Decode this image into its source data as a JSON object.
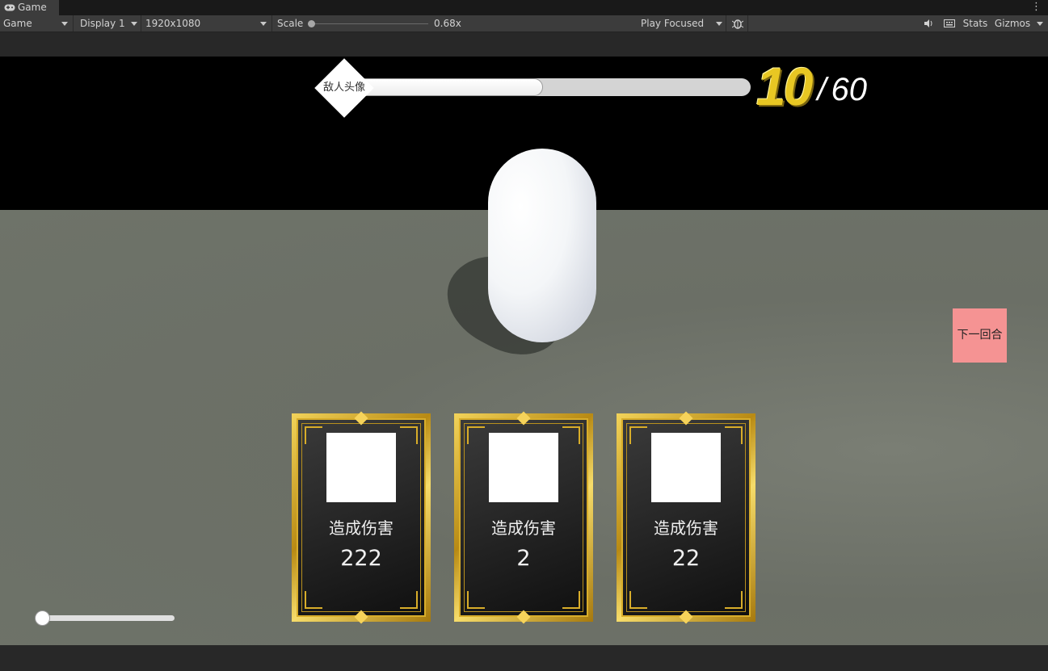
{
  "tab": {
    "title": "Game",
    "icon": "gamepad-icon",
    "menu_icon": "kebab-menu-icon"
  },
  "toolbar": {
    "view_mode": "Game",
    "display": "Display 1",
    "resolution": "1920x1080",
    "scale_label": "Scale",
    "scale_value": "0.68x",
    "scale_level": 0.0,
    "play_mode": "Play Focused",
    "stats_label": "Stats",
    "gizmos_label": "Gizmos",
    "icons": [
      "bug-icon",
      "speaker-icon",
      "keyboard-icon"
    ]
  },
  "hud": {
    "enemy_avatar_label": "敌人头像",
    "hp_current": "10",
    "hp_separator": "/",
    "hp_max": "60",
    "hp_fill_fraction": 0.48,
    "hp_colors": {
      "current": "#e8c723",
      "max": "#ffffff"
    },
    "next_turn_label": "下一回合",
    "next_turn_color": "#f59393",
    "bottom_slider_level": 0.02
  },
  "cards": [
    {
      "title": "造成伤害",
      "value": "222"
    },
    {
      "title": "造成伤害",
      "value": "2"
    },
    {
      "title": "造成伤害",
      "value": "22"
    }
  ]
}
